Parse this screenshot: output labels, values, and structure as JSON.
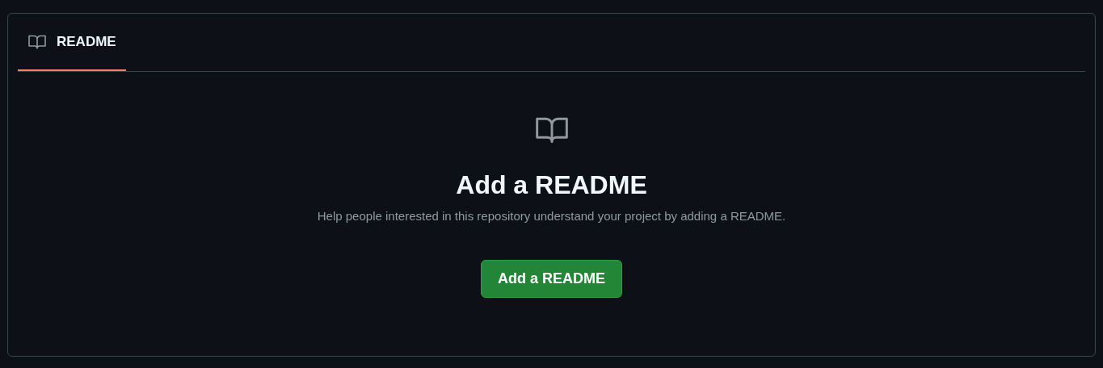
{
  "tabs": [
    {
      "label": "README",
      "selected": true
    }
  ],
  "empty_state": {
    "title": "Add a README",
    "description": "Help people interested in this repository understand your project by adding a README.",
    "button": "Add a README"
  }
}
